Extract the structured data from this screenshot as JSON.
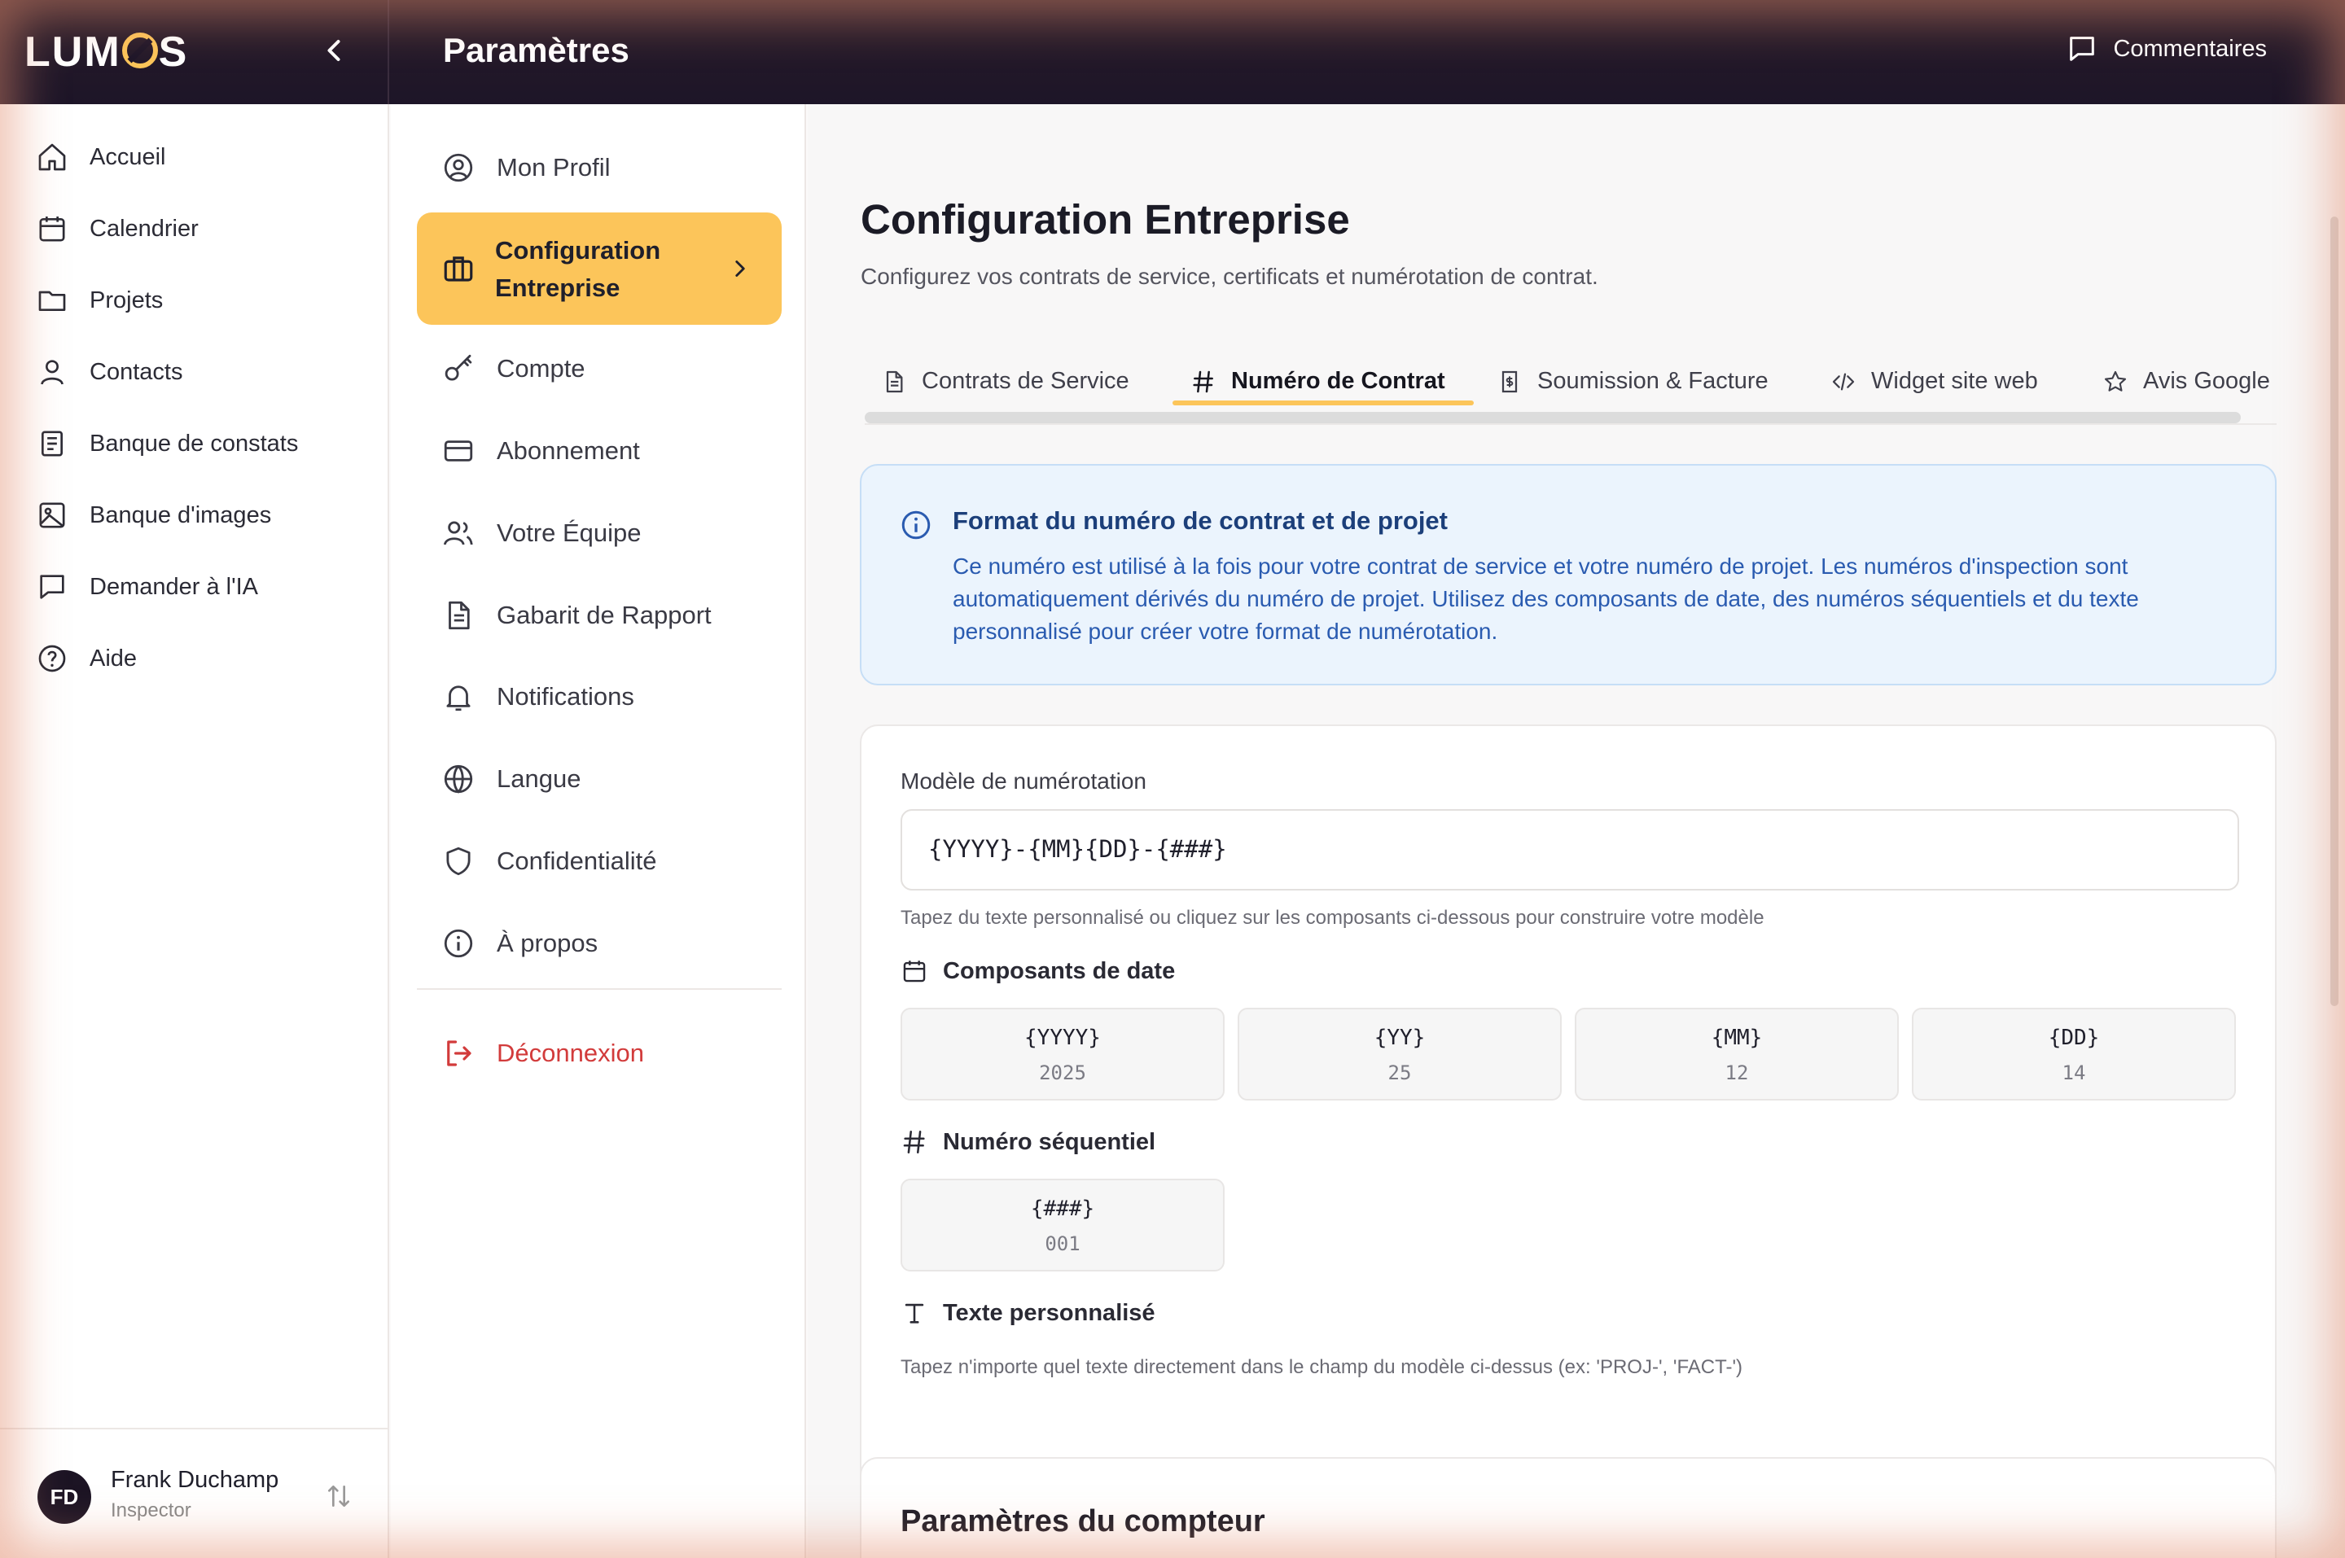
{
  "app": {
    "brand": "LUMOS",
    "page_heading": "Paramètres",
    "feedback_label": "Commentaires"
  },
  "sidebar": {
    "items": [
      {
        "label": "Accueil",
        "icon": "home-icon"
      },
      {
        "label": "Calendrier",
        "icon": "calendar-icon"
      },
      {
        "label": "Projets",
        "icon": "folder-icon"
      },
      {
        "label": "Contacts",
        "icon": "user-icon"
      },
      {
        "label": "Banque de constats",
        "icon": "clipboard-icon"
      },
      {
        "label": "Banque d'images",
        "icon": "image-icon"
      },
      {
        "label": "Demander à l'IA",
        "icon": "chat-icon"
      },
      {
        "label": "Aide",
        "icon": "help-icon"
      }
    ],
    "user": {
      "initials": "FD",
      "name": "Frank Duchamp",
      "role": "Inspector"
    }
  },
  "settings_menu": {
    "items": [
      {
        "label": "Mon Profil",
        "icon": "user-circle-icon"
      },
      {
        "label": "Configuration Entreprise",
        "icon": "briefcase-icon",
        "active": true
      },
      {
        "label": "Compte",
        "icon": "key-icon"
      },
      {
        "label": "Abonnement",
        "icon": "credit-card-icon"
      },
      {
        "label": "Votre Équipe",
        "icon": "users-icon"
      },
      {
        "label": "Gabarit de Rapport",
        "icon": "document-icon"
      },
      {
        "label": "Notifications",
        "icon": "bell-icon"
      },
      {
        "label": "Langue",
        "icon": "globe-icon"
      },
      {
        "label": "Confidentialité",
        "icon": "shield-icon"
      },
      {
        "label": "À propos",
        "icon": "info-icon"
      }
    ],
    "logout_label": "Déconnexion"
  },
  "main": {
    "title": "Configuration Entreprise",
    "subtitle": "Configurez vos contrats de service, certificats et numérotation de contrat.",
    "tabs": [
      {
        "label": "Contrats de Service",
        "icon": "document-icon"
      },
      {
        "label": "Numéro de Contrat",
        "icon": "hash-icon",
        "active": true
      },
      {
        "label": "Soumission & Facture",
        "icon": "invoice-icon"
      },
      {
        "label": "Widget site web",
        "icon": "code-icon"
      },
      {
        "label": "Avis Google",
        "icon": "star-icon"
      }
    ],
    "info": {
      "title": "Format du numéro de contrat et de projet",
      "body": "Ce numéro est utilisé à la fois pour votre contrat de service et votre numéro de projet. Les numéros d'inspection sont automatiquement dérivés du numéro de projet. Utilisez des composants de date, des numéros séquentiels et du texte personnalisé pour créer votre format de numérotation."
    },
    "numbering": {
      "label": "Modèle de numérotation",
      "value": "{YYYY}-{MM}{DD}-{###}",
      "hint": "Tapez du texte personnalisé ou cliquez sur les composants ci-dessous pour construire votre modèle",
      "date_section": "Composants de date",
      "date_components": [
        {
          "token": "{YYYY}",
          "example": "2025"
        },
        {
          "token": "{YY}",
          "example": "25"
        },
        {
          "token": "{MM}",
          "example": "12"
        },
        {
          "token": "{DD}",
          "example": "14"
        }
      ],
      "seq_section": "Numéro séquentiel",
      "seq_component": {
        "token": "{###}",
        "example": "001"
      },
      "text_section": "Texte personnalisé",
      "text_hint": "Tapez n'importe quel texte directement dans le champ du modèle ci-dessus (ex: 'PROJ-', 'FACT-')"
    },
    "counter_title": "Paramètres du compteur"
  },
  "colors": {
    "accent": "#fcc55a",
    "topbar": "#1d1528",
    "logout": "#d23b3b",
    "info_bg": "#ebf4fd",
    "info_text": "#2a5bb0"
  }
}
